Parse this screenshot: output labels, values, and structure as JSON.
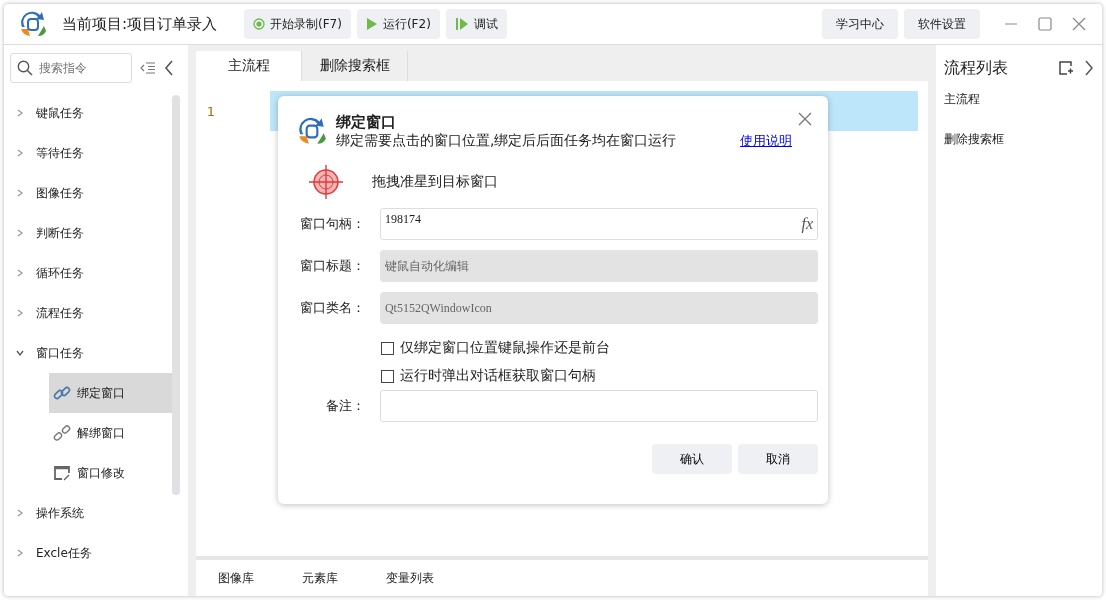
{
  "title_bar": {
    "project": "当前项目:项目订单录入",
    "toolbar": [
      {
        "label": "开始录制(F7)",
        "kind": "record"
      },
      {
        "label": "运行(F2)",
        "kind": "run"
      },
      {
        "label": "调试",
        "kind": "debug"
      }
    ],
    "right_buttons": [
      "学习中心",
      "软件设置"
    ]
  },
  "sidebar": {
    "search": {
      "placeholder": "搜索指令"
    },
    "items": [
      {
        "label": "键鼠任务",
        "expanded": false
      },
      {
        "label": "等待任务",
        "expanded": false
      },
      {
        "label": "图像任务",
        "expanded": false
      },
      {
        "label": "判断任务",
        "expanded": false
      },
      {
        "label": "循环任务",
        "expanded": false
      },
      {
        "label": "流程任务",
        "expanded": false
      },
      {
        "label": "窗口任务",
        "expanded": true,
        "children": [
          {
            "label": "绑定窗口",
            "kind": "link",
            "selected": true
          },
          {
            "label": "解绑窗口",
            "kind": "unlink",
            "selected": false
          },
          {
            "label": "窗口修改",
            "kind": "edit",
            "selected": false
          }
        ]
      },
      {
        "label": "操作系统",
        "expanded": false
      },
      {
        "label": "Excle任务",
        "expanded": false
      }
    ]
  },
  "editor": {
    "tabs": [
      {
        "label": "主流程",
        "selected": true
      },
      {
        "label": "删除搜索框",
        "selected": false
      }
    ],
    "lines": [
      {
        "number": "1",
        "selected": true
      }
    ],
    "bottom_tabs": [
      "图像库",
      "元素库",
      "变量列表"
    ]
  },
  "process_list": {
    "title": "流程列表",
    "items": [
      "主流程",
      "删除搜索框"
    ]
  },
  "dialog": {
    "title": "绑定窗口",
    "subtitle": "绑定需要点击的窗口位置,绑定后后面任务均在窗口运行",
    "help_link": "使用说明",
    "drag_hint": "拖拽准星到目标窗口",
    "fields": [
      {
        "label": "窗口句柄：",
        "value": "198174",
        "disabled": false,
        "button": "fx"
      },
      {
        "label": "窗口标题：",
        "value": "键鼠自动化编辑",
        "disabled": true
      },
      {
        "label": "窗口类名：",
        "value": "Qt5152QWindowIcon",
        "disabled": true
      }
    ],
    "checkboxes": [
      {
        "label": "仅绑定窗口位置键鼠操作还是前台",
        "checked": false
      },
      {
        "label": "运行时弹出对话框获取窗口句柄",
        "checked": false
      }
    ],
    "remark": {
      "label": "备注："
    },
    "buttons": [
      "确认",
      "取消"
    ]
  }
}
